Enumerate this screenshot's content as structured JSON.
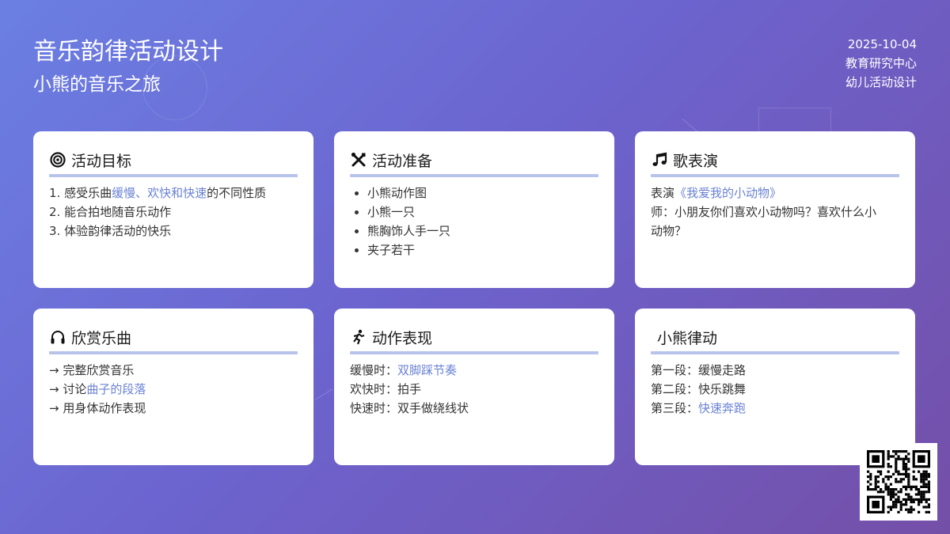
{
  "header": {
    "title": "音乐韵律活动设计",
    "subtitle": "小熊的音乐之旅",
    "date": "2025-10-04",
    "org": "教育研究中心",
    "category": "幼儿活动设计"
  },
  "colors": {
    "accent": "#6a82d4",
    "rule": "#b7c3ea"
  },
  "cards": {
    "goals": {
      "icon": "target-icon",
      "title": "活动目标",
      "items": [
        {
          "num": "1.",
          "pre": "感受乐曲",
          "hl": "缓慢、欢快和快速",
          "post": "的不同性质"
        },
        {
          "num": "2.",
          "pre": "能合拍地随音乐动作",
          "hl": "",
          "post": ""
        },
        {
          "num": "3.",
          "pre": "体验韵律活动的快乐",
          "hl": "",
          "post": ""
        }
      ]
    },
    "prep": {
      "icon": "tools-icon",
      "title": "活动准备",
      "items": [
        "小熊动作图",
        "小熊一只",
        "熊胸饰人手一只",
        "夹子若干"
      ]
    },
    "song": {
      "icon": "music-note-icon",
      "title": "歌表演",
      "line1_pre": "表演",
      "line1_hl": "《我爱我的小动物》",
      "line2": "师：小朋友你们喜欢小动物吗？喜欢什么小",
      "line3": "动物？"
    },
    "listen": {
      "icon": "headphones-icon",
      "title": "欣赏乐曲",
      "items": [
        {
          "pre": "→ 完整欣赏音乐",
          "hl": ""
        },
        {
          "pre": "→ 讨论",
          "hl": "曲子的段落"
        },
        {
          "pre": "→ 用身体动作表现",
          "hl": ""
        }
      ]
    },
    "moves": {
      "icon": "running-icon",
      "title": "动作表现",
      "items": [
        {
          "pre": "缓慢时：",
          "hl": "双脚踩节奏",
          "post": ""
        },
        {
          "pre": "欢快时：拍手",
          "hl": "",
          "post": ""
        },
        {
          "pre": "快速时：双手做绕线状",
          "hl": "",
          "post": ""
        }
      ]
    },
    "rhythm": {
      "title": "小熊律动",
      "items": [
        {
          "pre": "第一段：缓慢走路",
          "hl": ""
        },
        {
          "pre": "第二段：快乐跳舞",
          "hl": ""
        },
        {
          "pre": "第三段：",
          "hl": "快速奔跑"
        }
      ]
    }
  }
}
